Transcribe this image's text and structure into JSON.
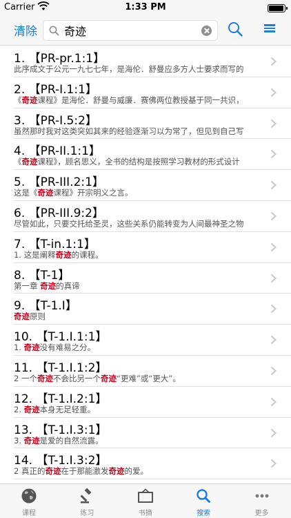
{
  "status": {
    "carrier": "Carrier",
    "time": "1:33 PM"
  },
  "header": {
    "clear_label": "清除",
    "search_value": "奇迹"
  },
  "results": [
    {
      "title": "1. 【PR-pr.1:1】",
      "snippet": [
        {
          "t": "此序成文于公元一九七七年，是海伦．舒曼应多方人士要求而写的"
        }
      ]
    },
    {
      "title": "2. 【PR-I.1:1】",
      "snippet": [
        {
          "t": "《"
        },
        {
          "t": "奇迹",
          "hl": true
        },
        {
          "t": "课程》是海伦．舒曼与威廉．赛佛两位教授基于同一共识，"
        }
      ]
    },
    {
      "title": "3. 【PR-I.5:2】",
      "snippet": [
        {
          "t": "虽然那时我对这类突如其来的经验逐渐习以为常了，但见到自己写"
        }
      ]
    },
    {
      "title": "4. 【PR-II.1:1】",
      "snippet": [
        {
          "t": "《"
        },
        {
          "t": "奇迹",
          "hl": true
        },
        {
          "t": "课程》，顾名思义，全书的结构是按照学习教材的形式设计"
        }
      ]
    },
    {
      "title": "5. 【PR-III.2:1】",
      "snippet": [
        {
          "t": "这是《"
        },
        {
          "t": "奇迹",
          "hl": true
        },
        {
          "t": "课程》开宗明义之言。"
        }
      ]
    },
    {
      "title": "6. 【PR-III.9:2】",
      "snippet": [
        {
          "t": "尽管如此，只要交托给圣灵，这些关系仍能转变为人间最神圣之物"
        }
      ]
    },
    {
      "title": "7. 【T-in.1:1】",
      "snippet": [
        {
          "t": "1. 这是阐释"
        },
        {
          "t": "奇迹",
          "hl": true
        },
        {
          "t": "的课程。"
        }
      ]
    },
    {
      "title": "8. 【T-1】",
      "snippet": [
        {
          "t": "第一章 "
        },
        {
          "t": "奇迹",
          "hl": true
        },
        {
          "t": "的真谛"
        }
      ]
    },
    {
      "title": "9. 【T-1.I】",
      "snippet": [
        {
          "t": "奇迹",
          "hl": true
        },
        {
          "t": "原则"
        }
      ]
    },
    {
      "title": "10. 【T-1.I.1:1】",
      "snippet": [
        {
          "t": "1. "
        },
        {
          "t": "奇迹",
          "hl": true
        },
        {
          "t": "没有难易之分。"
        }
      ]
    },
    {
      "title": "11. 【T-1.I.1:2】",
      "snippet": [
        {
          "t": "2 一个"
        },
        {
          "t": "奇迹",
          "hl": true
        },
        {
          "t": "不会比另一个"
        },
        {
          "t": "奇迹",
          "hl": true
        },
        {
          "t": "“更难”或“更大”。"
        }
      ]
    },
    {
      "title": "12. 【T-1.I.2:1】",
      "snippet": [
        {
          "t": "2. "
        },
        {
          "t": "奇迹",
          "hl": true
        },
        {
          "t": "本身无足轻重。"
        }
      ]
    },
    {
      "title": "13. 【T-1.I.3:1】",
      "snippet": [
        {
          "t": "3. "
        },
        {
          "t": "奇迹",
          "hl": true
        },
        {
          "t": "是爱的自然流露。"
        }
      ]
    },
    {
      "title": "14. 【T-1.I.3:2】",
      "snippet": [
        {
          "t": "2 真正的"
        },
        {
          "t": "奇迹",
          "hl": true
        },
        {
          "t": "在于那能激发"
        },
        {
          "t": "奇迹",
          "hl": true
        },
        {
          "t": "的爱。"
        }
      ]
    }
  ],
  "tabs": [
    {
      "label": "课程",
      "icon": "globe-icon",
      "active": false
    },
    {
      "label": "练习",
      "icon": "gavel-icon",
      "active": false
    },
    {
      "label": "书摘",
      "icon": "frame-icon",
      "active": false
    },
    {
      "label": "搜索",
      "icon": "search-icon",
      "active": true
    },
    {
      "label": "更多",
      "icon": "more-icon",
      "active": false
    }
  ],
  "colors": {
    "accent": "#1b7de0",
    "highlight": "#d0021b",
    "inactive": "#8e8e93"
  }
}
